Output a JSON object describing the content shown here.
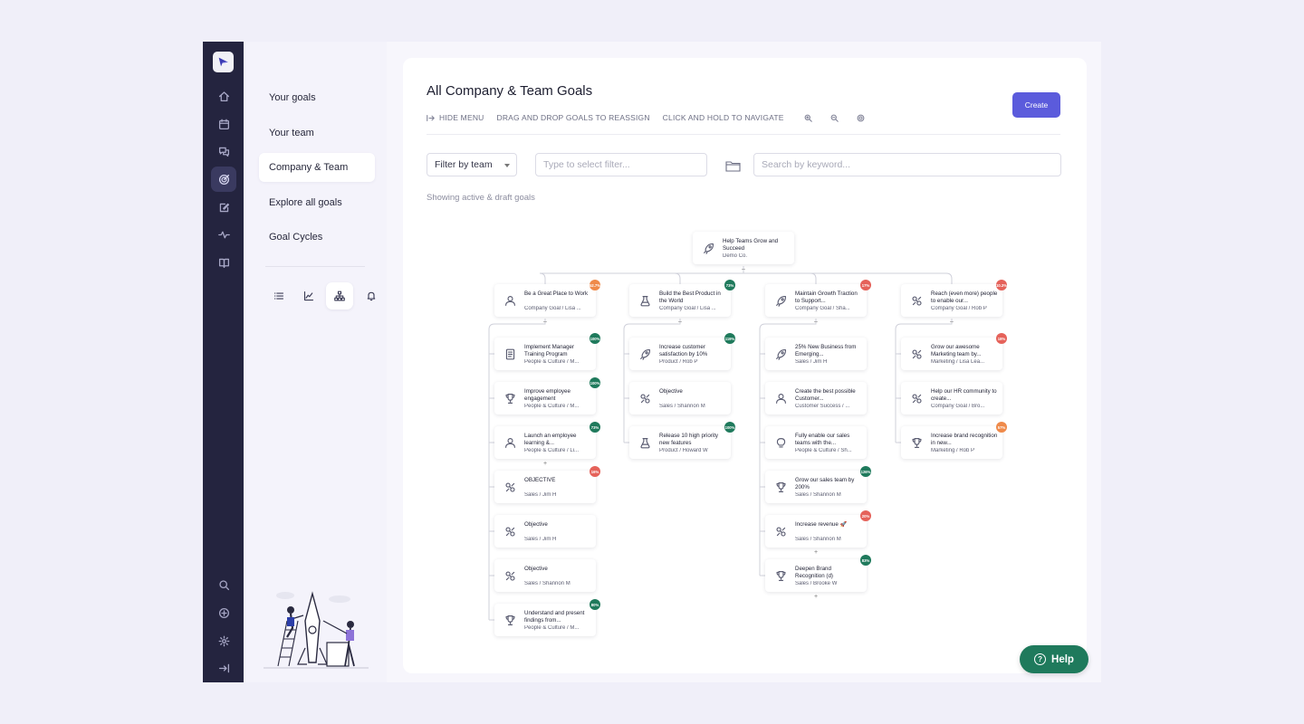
{
  "colors": {
    "accent": "#5b5bdc",
    "rail": "#24243f",
    "help": "#1f7a5c",
    "badge_green": "#1f7a5c",
    "badge_orange": "#ef8a4a",
    "badge_red": "#e5625a"
  },
  "rail": {
    "top_icons": [
      "home-icon",
      "calendar-icon",
      "chat-icon",
      "goals-icon",
      "edit-icon",
      "activity-icon",
      "book-icon"
    ],
    "bottom_icons": [
      "search-icon",
      "add-icon",
      "settings-icon",
      "collapse-icon"
    ]
  },
  "subnav": {
    "items": [
      {
        "label": "Your goals"
      },
      {
        "label": "Your team"
      },
      {
        "label": "Company & Team"
      },
      {
        "label": "Explore all goals"
      },
      {
        "label": "Goal Cycles"
      }
    ],
    "view_icons": [
      "list-icon",
      "chart-icon",
      "org-tree-icon",
      "bell-icon"
    ]
  },
  "main": {
    "title": "All Company & Team Goals",
    "toolbar": {
      "hide_menu": "HIDE MENU",
      "drag": "DRAG AND DROP GOALS TO REASSIGN",
      "click_hold": "CLICK AND HOLD TO NAVIGATE"
    },
    "create_label": "Create",
    "filter_team": "Filter by team",
    "filter_placeholder": "Type to select filter...",
    "search_placeholder": "Search by keyword...",
    "showing": "Showing active & draft goals"
  },
  "tree": {
    "root": {
      "title": "Help Teams Grow and Succeed",
      "sub": "Demo Co.",
      "icon": "rocket-icon"
    },
    "columns": [
      {
        "head": {
          "title": "Be a Great Place to Work",
          "sub": "Company Goal / Lisa ...",
          "icon": "person-icon",
          "badge": "52.7%",
          "badge_color": "#ef8a4a"
        },
        "children": [
          {
            "title": "Implement Manager Training Program",
            "sub": "People & Culture / M...",
            "icon": "doc-icon",
            "badge": "100%",
            "badge_color": "#1f7a5c"
          },
          {
            "title": "Improve employee engagement",
            "sub": "People & Culture / M...",
            "icon": "trophy-icon",
            "badge": "100%",
            "badge_color": "#1f7a5c"
          },
          {
            "title": "Launch an employee learning &...",
            "sub": "People & Culture / Li...",
            "icon": "person-icon",
            "badge": "73%",
            "badge_color": "#1f7a5c",
            "plus": true
          },
          {
            "title": "OBJECTIVE",
            "sub": "Sales / Jim H",
            "icon": "objective-icon",
            "badge": "16%",
            "badge_color": "#e5625a"
          },
          {
            "title": "Objective",
            "sub": "Sales / Jim H",
            "icon": "objective-icon"
          },
          {
            "title": "Objective",
            "sub": "Sales / Shannon M",
            "icon": "objective-icon"
          },
          {
            "title": "Understand and present findings from...",
            "sub": "People & Culture / M...",
            "icon": "trophy-icon",
            "badge": "80%",
            "badge_color": "#1f7a5c"
          }
        ]
      },
      {
        "head": {
          "title": "Build the Best Product in the World",
          "sub": "Company Goal / Lisa ...",
          "icon": "flask-icon",
          "badge": "73%",
          "badge_color": "#1f7a5c"
        },
        "children": [
          {
            "title": "Increase customer satisfaction by 10%",
            "sub": "Product / Rob P",
            "icon": "rocket-icon",
            "badge": "119%",
            "badge_color": "#1f7a5c"
          },
          {
            "title": "Objective",
            "sub": "Sales / Shannon M",
            "icon": "objective-icon"
          },
          {
            "title": "Release 10 high priority new features",
            "sub": "Product / Howard W",
            "icon": "flask-icon",
            "badge": "100%",
            "badge_color": "#1f7a5c"
          }
        ]
      },
      {
        "head": {
          "title": "Maintain Growth Traction to Support...",
          "sub": "Company Goal / Sha...",
          "icon": "rocket-icon",
          "badge": "17%",
          "badge_color": "#e5625a"
        },
        "children": [
          {
            "title": "25% New Business from Emerging...",
            "sub": "Sales / Jim H",
            "icon": "rocket-icon"
          },
          {
            "title": "Create the best possible Customer...",
            "sub": "Customer Success / ...",
            "icon": "person-icon"
          },
          {
            "title": "Fully enable our sales teams with the...",
            "sub": "People & Culture / Sh...",
            "icon": "bulb-icon"
          },
          {
            "title": "Grow our sales team by 200%",
            "sub": "Sales / Shannon M",
            "icon": "trophy-icon",
            "badge": "126%",
            "badge_color": "#1f7a5c"
          },
          {
            "title": "Increase revenue 🚀",
            "sub": "Sales / Shannon M",
            "icon": "objective-icon",
            "badge": "20%",
            "badge_color": "#e5625a",
            "plus": true
          },
          {
            "title": "Deepen Brand Recognition (d)",
            "sub": "Sales / Brooke W",
            "icon": "trophy-icon",
            "badge": "83%",
            "badge_color": "#1f7a5c",
            "plus": true
          }
        ]
      },
      {
        "head": {
          "title": "Reach (even more) people to enable our...",
          "sub": "Company Goal / Rob P",
          "icon": "objective-icon",
          "badge": "10.3%",
          "badge_color": "#e5625a"
        },
        "children": [
          {
            "title": "Grow our awesome Marketing team by...",
            "sub": "Marketing / Lisa Lea...",
            "icon": "objective-icon",
            "badge": "18%",
            "badge_color": "#e5625a"
          },
          {
            "title": "Help our HR community to create...",
            "sub": "Company Goal / Bro...",
            "icon": "objective-icon"
          },
          {
            "title": "Increase brand recognition in new...",
            "sub": "Marketing / Rob P",
            "icon": "trophy-icon",
            "badge": "57%",
            "badge_color": "#ef8a4a"
          }
        ]
      }
    ]
  },
  "help": {
    "label": "Help"
  }
}
